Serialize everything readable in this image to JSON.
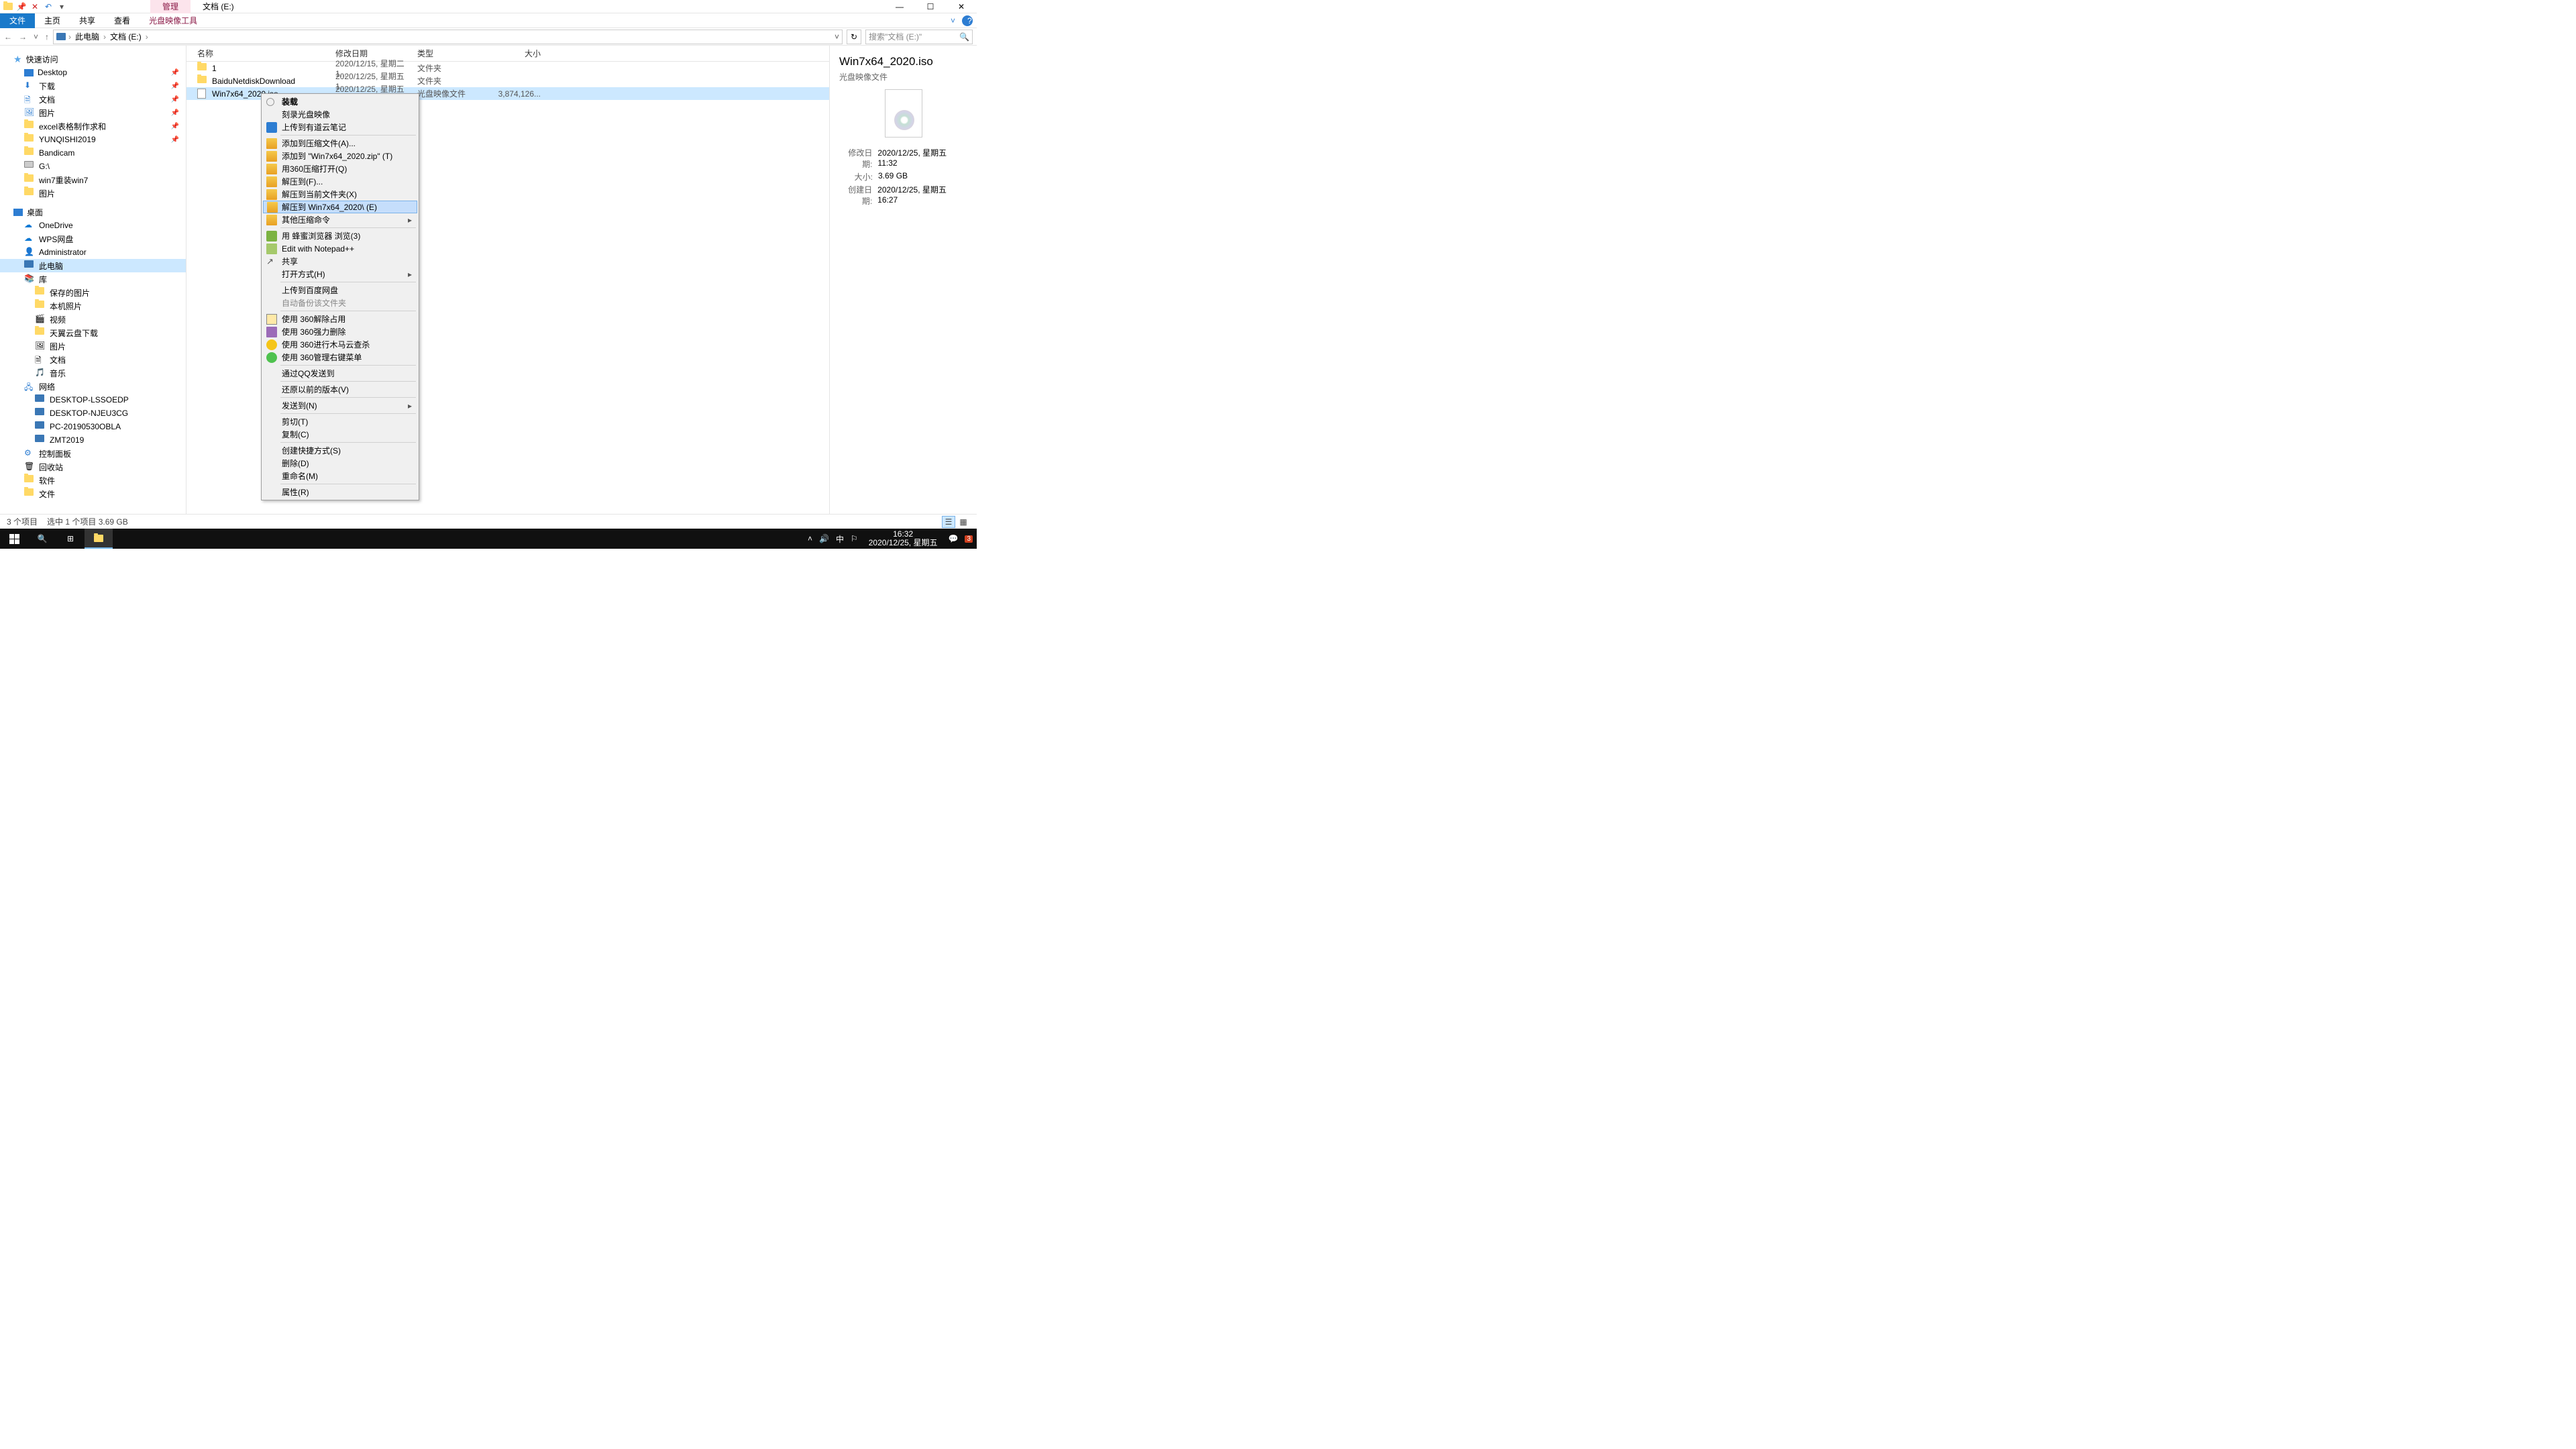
{
  "title_tabs": {
    "manage": "管理",
    "location": "文档 (E:)"
  },
  "ribbon": {
    "file": "文件",
    "home": "主页",
    "share": "共享",
    "view": "查看",
    "disc": "光盘映像工具"
  },
  "breadcrumb": {
    "pc": "此电脑",
    "drive": "文档 (E:)"
  },
  "search": {
    "placeholder": "搜索\"文档 (E:)\""
  },
  "nav": {
    "quick": "快速访问",
    "quick_items": [
      "Desktop",
      "下载",
      "文档",
      "图片",
      "excel表格制作求和",
      "YUNQISHI2019",
      "Bandicam",
      "G:\\",
      "win7重装win7",
      "图片"
    ],
    "desktop": "桌面",
    "desktop_items": [
      "OneDrive",
      "WPS网盘",
      "Administrator",
      "此电脑",
      "库"
    ],
    "lib_items": [
      "保存的图片",
      "本机照片",
      "视频",
      "天翼云盘下载",
      "图片",
      "文档",
      "音乐"
    ],
    "network": "网络",
    "net_items": [
      "DESKTOP-LSSOEDP",
      "DESKTOP-NJEU3CG",
      "PC-20190530OBLA",
      "ZMT2019"
    ],
    "other": [
      "控制面板",
      "回收站",
      "软件",
      "文件"
    ]
  },
  "cols": {
    "name": "名称",
    "date": "修改日期",
    "type": "类型",
    "size": "大小"
  },
  "rows": [
    {
      "name": "1",
      "date": "2020/12/15, 星期二 1...",
      "type": "文件夹",
      "size": ""
    },
    {
      "name": "BaiduNetdiskDownload",
      "date": "2020/12/25, 星期五 1...",
      "type": "文件夹",
      "size": ""
    },
    {
      "name": "Win7x64_2020.iso",
      "date": "2020/12/25, 星期五 1...",
      "type": "光盘映像文件",
      "size": "3,874,126..."
    }
  ],
  "ctx": {
    "mount": "装载",
    "burn": "刻录光盘映像",
    "youdao": "上传到有道云笔记",
    "addarchive": "添加到压缩文件(A)...",
    "addzip": "添加到 \"Win7x64_2020.zip\" (T)",
    "open360": "用360压缩打开(Q)",
    "extractto": "解压到(F)...",
    "extractcur": "解压到当前文件夹(X)",
    "extractname": "解压到 Win7x64_2020\\ (E)",
    "othercomp": "其他压缩命令",
    "bee": "用 蜂蜜浏览器 浏览(3)",
    "npp": "Edit with Notepad++",
    "share": "共享",
    "openwith": "打开方式(H)",
    "baidu": "上传到百度网盘",
    "autobak": "自动备份该文件夹",
    "u360a": "使用 360解除占用",
    "u360b": "使用 360强力删除",
    "u360c": "使用 360进行木马云查杀",
    "u360d": "使用 360管理右键菜单",
    "qq": "通过QQ发送到",
    "restore": "还原以前的版本(V)",
    "sendto": "发送到(N)",
    "cut": "剪切(T)",
    "copy": "复制(C)",
    "shortcut": "创建快捷方式(S)",
    "delete": "删除(D)",
    "rename": "重命名(M)",
    "props": "属性(R)"
  },
  "preview": {
    "title": "Win7x64_2020.iso",
    "type": "光盘映像文件",
    "k_mod": "修改日期:",
    "v_mod": "2020/12/25, 星期五 11:32",
    "k_size": "大小:",
    "v_size": "3.69 GB",
    "k_create": "创建日期:",
    "v_create": "2020/12/25, 星期五 16:27"
  },
  "status": {
    "count": "3 个项目",
    "sel": "选中 1 个项目  3.69 GB"
  },
  "clock": {
    "time": "16:32",
    "date": "2020/12/25, 星期五"
  },
  "tray": {
    "ime": "中",
    "badge": "3"
  }
}
